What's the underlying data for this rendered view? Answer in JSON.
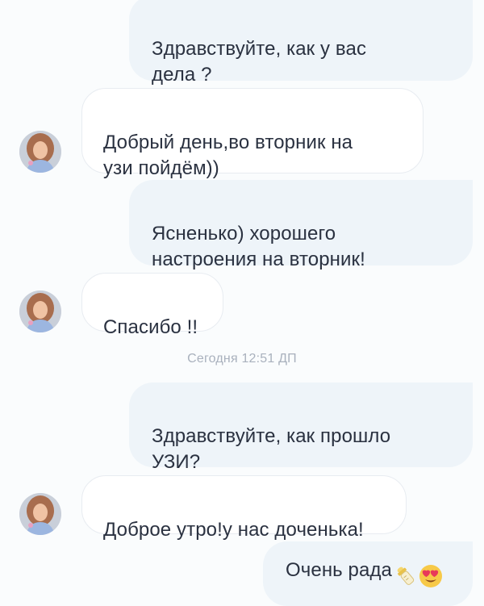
{
  "messages": [
    {
      "direction": "outgoing",
      "text": "Здравствуйте, как у вас\nдела ?"
    },
    {
      "direction": "incoming",
      "text": "Добрый день,во вторник на\nузи пойдём))"
    },
    {
      "direction": "outgoing",
      "text": "Ясненько) хорошего\nнастроения на вторник!"
    },
    {
      "direction": "incoming",
      "text": "Спасибо !!"
    },
    {
      "direction": "outgoing",
      "text": "Здравствуйте, как прошло\nУЗИ?"
    },
    {
      "direction": "incoming",
      "text": "Доброе утро!у нас доченька!"
    },
    {
      "direction": "outgoing",
      "text": "Очень рада",
      "emoji": [
        "baby-bottle-icon",
        "heart-eyes-face-icon"
      ]
    }
  ],
  "timestamp": "Сегодня 12:51 ДП",
  "colors": {
    "background": "#fafcfd",
    "outgoing_bubble": "#eef4f9",
    "incoming_bubble": "#ffffff",
    "text": "#2a3140",
    "timestamp": "#a9b1bd"
  }
}
